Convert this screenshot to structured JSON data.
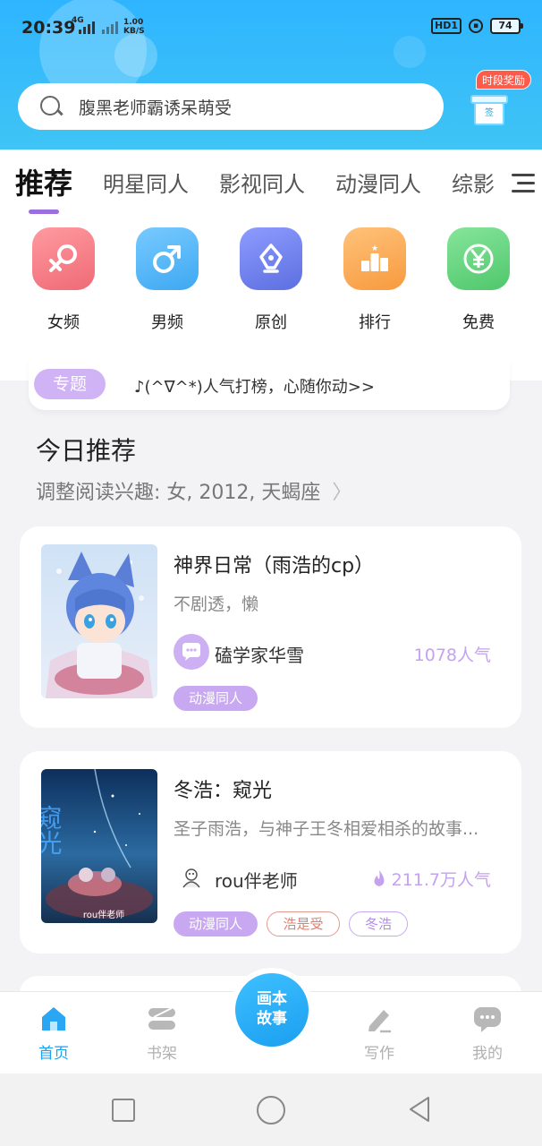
{
  "status": {
    "time": "20:39",
    "net": "4G",
    "speed_value": "1.00",
    "speed_unit": "KB/S",
    "hd": "HD1",
    "battery": "74"
  },
  "search": {
    "placeholder": "腹黑老师霸诱呆萌受"
  },
  "reward": {
    "label": "时段奖励",
    "gift_text": "签"
  },
  "tabs": [
    "推荐",
    "明星同人",
    "影视同人",
    "动漫同人",
    "综影"
  ],
  "categories": [
    {
      "label": "女频",
      "icon": "female-icon",
      "color": "#f0727c"
    },
    {
      "label": "男频",
      "icon": "male-icon",
      "color": "#4fb3f6"
    },
    {
      "label": "原创",
      "icon": "pen-icon",
      "color": "#6b7de8"
    },
    {
      "label": "排行",
      "icon": "ranking-icon",
      "color": "#f8a74c"
    },
    {
      "label": "免费",
      "icon": "yen-icon",
      "color": "#5bd07a"
    }
  ],
  "topic": {
    "tag": "专题",
    "text": "♪(^∇^*)人气打榜，心随你动>>"
  },
  "section": {
    "title": "今日推荐",
    "subtitle": "调整阅读兴趣: 女, 2012, 天蝎座"
  },
  "books": [
    {
      "title": "神界日常（雨浩的cp）",
      "desc": "不剧透，懒",
      "author": "磕学家华雪",
      "popularity": "1078人气",
      "tags": [
        "动漫同人"
      ]
    },
    {
      "title": "冬浩：窥光",
      "desc": "圣子雨浩，与神子王冬相爱相杀的故事...",
      "author": "rou伴老师",
      "popularity": "211.7万人气",
      "tags": [
        "动漫同人",
        "浩是受",
        "冬浩"
      ],
      "cover_title": "窥光",
      "cover_author": "rou伴老师"
    }
  ],
  "nav": {
    "home": "首页",
    "shelf": "书架",
    "center": "画本故事",
    "write": "写作",
    "mine": "我的"
  },
  "colors": {
    "accent": "#1aa2f0",
    "purple": "#c9a8f2",
    "header_blue": "#2fb5ff"
  }
}
